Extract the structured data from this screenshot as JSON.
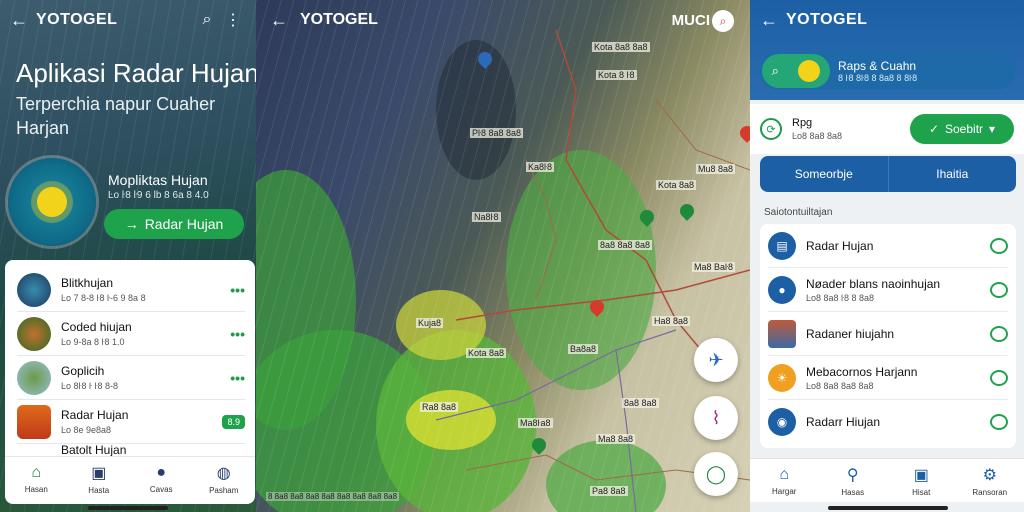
{
  "panel1": {
    "topbar": {
      "title": "YOTOGEL",
      "back_icon": "arrow-left-icon",
      "search_icon": "search-icon",
      "menu_icon": "more-vertical-icon"
    },
    "hero_title": "Aplikasi Radar Hujan",
    "hero_subtitle": "Terperchia napur Cuaher Harjan",
    "app_name": "Mopliktas Hujan",
    "app_meta": "Ŀo ŀ8 ŀ9 6 lb 8 6a 8 4.0",
    "cta_label": "Radar Hujan",
    "cta_icon": "→",
    "list": [
      {
        "name": "Blitkhujan",
        "sub": "Ŀo 7 8-8 ŀ8 ŀ-6 9 8a 8",
        "trailing": "•••"
      },
      {
        "name": "Coded hiujan",
        "sub": "Ŀo 9-8a 8 ŀ8 1.0",
        "trailing": "•••"
      },
      {
        "name": "Goplicih",
        "sub": "Ŀo 8ŀ8 ŀ ŀ8 8-8",
        "trailing": "•••"
      },
      {
        "name": "Radar Hujan",
        "sub": "Ŀo 8e 9e8a8",
        "trailing": "8.9"
      },
      {
        "name": "Batolt Hujan",
        "sub": "",
        "trailing": ""
      }
    ],
    "bottomnav": [
      {
        "label": "Hasan",
        "icon": "home-icon"
      },
      {
        "label": "Hasta",
        "icon": "map-icon"
      },
      {
        "label": "Cavas",
        "icon": "globe-icon"
      },
      {
        "label": "Pasham",
        "icon": "user-icon"
      }
    ]
  },
  "panel2": {
    "title": "YOTOGEL",
    "corner_text": "MUCI",
    "labels": [
      "Kota 8a8 8a8",
      "Kota 8 ŀ8",
      "Pŀ8 8a8 8a8",
      "Ka8ŀ8",
      "Na8ŀ8",
      "Kota 8a8",
      "Mu8 8a8",
      "8a8 8a8 8a8",
      "Ma8 Baŀ8",
      "Ha8 8a8",
      "Kuja8",
      "Kota 8a8",
      "Ba8a8",
      "Ra8 8a8",
      "Ma8ŀa8",
      "Ma8 8a8",
      "Pa8 8a8",
      "8a8 8a8"
    ],
    "fab_icons": [
      "plane-icon",
      "route-icon",
      "chat-icon"
    ],
    "attribution": "8 8a8 8a8 8a8 8a8 8a8 8a8 8a8 8a8"
  },
  "panel3": {
    "topbar": {
      "title": "YOTOGEL"
    },
    "feature": {
      "name": "Raps & Cuahn",
      "sub": "8 ŀ8 8ŀ8 8 8a8 8 8ŀ8"
    },
    "region": {
      "title": "Rpg",
      "sub": "Ŀo8 8a8 8a8",
      "button": "Soebitr"
    },
    "tabs": [
      "Someorbje",
      "Ihaitia"
    ],
    "section": "Saiotontuiltajan",
    "list": [
      {
        "name": "Radar Hujan",
        "sub": ""
      },
      {
        "name": "Nøader blans naoinhujan",
        "sub": "Ŀo8 8a8 ŀ8 8 8a8"
      },
      {
        "name": "Radaner hiujahn",
        "sub": ""
      },
      {
        "name": "Mebacornos Harjann",
        "sub": "Ŀo8 8a8 8a8 8a8"
      },
      {
        "name": "Radarr Hiujan",
        "sub": ""
      }
    ],
    "bottomnav": [
      {
        "label": "Hargar",
        "icon": "home-icon"
      },
      {
        "label": "Hasas",
        "icon": "person-search-icon"
      },
      {
        "label": "Hisat",
        "icon": "layers-icon"
      },
      {
        "label": "Ransoran",
        "icon": "settings-icon"
      }
    ]
  }
}
